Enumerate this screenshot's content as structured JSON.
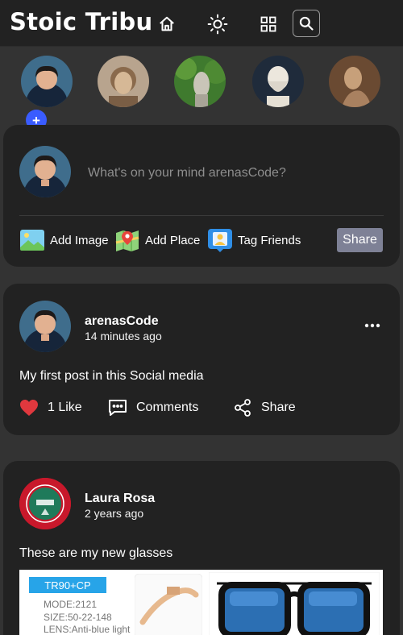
{
  "app": {
    "title": "Stoic Tribu",
    "icons": [
      "home-icon",
      "sun-icon",
      "grid-icon",
      "search-icon"
    ]
  },
  "stories": {
    "add_label": "+",
    "items": [
      "story-own",
      "story-marcus-aurelius",
      "story-statue-garden",
      "story-aristotle",
      "story-seneca"
    ]
  },
  "composer": {
    "placeholder": "What's on your mind arenasCode?",
    "actions": {
      "add_image": "Add Image",
      "add_place": "Add Place",
      "tag_friends": "Tag Friends"
    },
    "share_label": "Share"
  },
  "posts": [
    {
      "author": "arenasCode",
      "time": "14 minutes ago",
      "text": "My first post in this Social media",
      "like_label": "1 Like",
      "comments_label": "Comments",
      "share_label": "Share"
    },
    {
      "author": "Laura Rosa",
      "time": "2 years ago",
      "text": "These are my new glasses",
      "image": {
        "badge": "TR90+CP",
        "specs": [
          "MODE:2121",
          "SIZE:50-22-148",
          "LENS:Anti-blue light"
        ]
      }
    }
  ],
  "colors": {
    "background": "#333333",
    "card": "#222222",
    "share_button": "#7e8196",
    "like_heart": "#e0383e",
    "story_add": "#3a5cff"
  }
}
